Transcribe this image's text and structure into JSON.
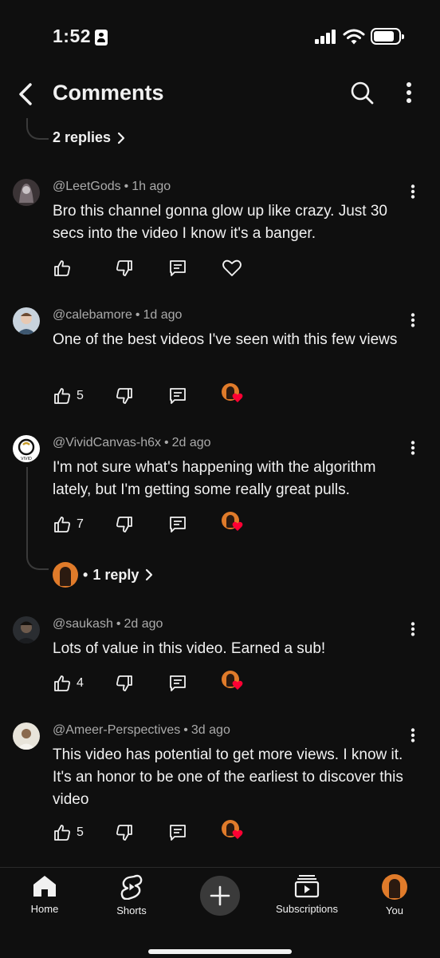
{
  "status_bar": {
    "time": "1:52"
  },
  "header": {
    "title": "Comments"
  },
  "top_thread": {
    "replies_label": "2 replies"
  },
  "comments": [
    {
      "author": "@LeetGods",
      "age": "1h ago",
      "text": "Bro this channel gonna glow up like crazy. Just 30 secs into the video I know it's a banger.",
      "likes": "",
      "creator_hearted": false
    },
    {
      "author": "@calebamore",
      "age": "1d ago",
      "text": "One of the best videos I've seen with this few views",
      "likes": "5",
      "creator_hearted": true
    },
    {
      "author": "@VividCanvas-h6x",
      "age": "2d ago",
      "text": "I'm not sure what's happening with the algorithm lately, but I'm getting some really great pulls.",
      "likes": "7",
      "creator_hearted": true,
      "replies_label": "1 reply"
    },
    {
      "author": "@saukash",
      "age": "2d ago",
      "text": "Lots of value in this video. Earned a sub!",
      "likes": "4",
      "creator_hearted": true
    },
    {
      "author": "@Ameer-Perspectives",
      "age": "3d ago",
      "text": "This video has potential to get more views. I know it. It's an honor to be one of the earliest to discover this video",
      "likes": "5",
      "creator_hearted": true
    }
  ],
  "bottom_nav": [
    {
      "label": "Home",
      "icon": "home-icon"
    },
    {
      "label": "Shorts",
      "icon": "shorts-icon"
    },
    {
      "label": "",
      "icon": "plus-icon"
    },
    {
      "label": "Subscriptions",
      "icon": "subscriptions-icon"
    },
    {
      "label": "You",
      "icon": "avatar"
    }
  ],
  "colors": {
    "background": "#0f0f0f",
    "text": "#f1f1f1",
    "secondary_text": "#aaaaaa",
    "heart_red": "#ff0033",
    "avatar_orange": "#e07b2a"
  }
}
